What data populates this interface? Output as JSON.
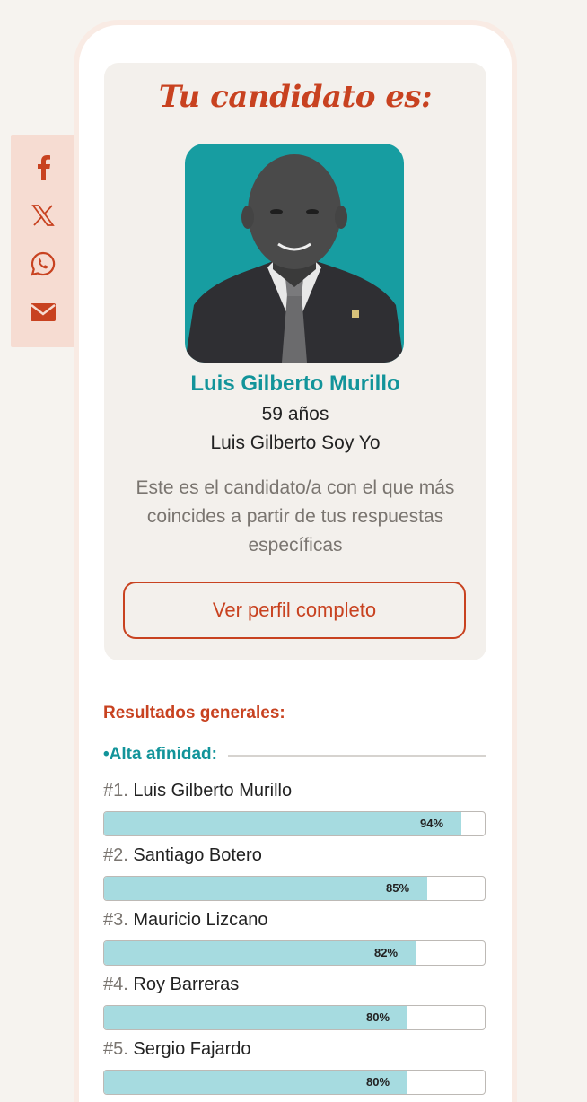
{
  "hero": {
    "title": "Tu candidato es:",
    "name": "Luis Gilberto Murillo",
    "age": "59 años",
    "party": "Luis Gilberto Soy Yo",
    "description": "Este es el candidato/a con el que más coincides a partir de tus respuestas específicas",
    "button_label": "Ver perfil completo"
  },
  "share": {
    "icons": [
      "facebook-icon",
      "x-icon",
      "whatsapp-icon",
      "email-icon"
    ]
  },
  "results": {
    "title": "Resultados generales:",
    "affinity_label": "•Alta afinidad:",
    "rows": [
      {
        "rank": "#1.",
        "name": "Luis Gilberto Murillo",
        "value": 94,
        "label": "94%"
      },
      {
        "rank": "#2.",
        "name": "Santiago Botero",
        "value": 85,
        "label": "85%"
      },
      {
        "rank": "#3.",
        "name": "Mauricio Lizcano",
        "value": 82,
        "label": "82%"
      },
      {
        "rank": "#4.",
        "name": "Roy Barreras",
        "value": 80,
        "label": "80%"
      },
      {
        "rank": "#5.",
        "name": "Sergio Fajardo",
        "value": 80,
        "label": "80%"
      }
    ]
  },
  "colors": {
    "accent": "#c84220",
    "teal": "#12949a",
    "bar_fill": "#a6dbe0",
    "photo_bg": "#179da1"
  }
}
